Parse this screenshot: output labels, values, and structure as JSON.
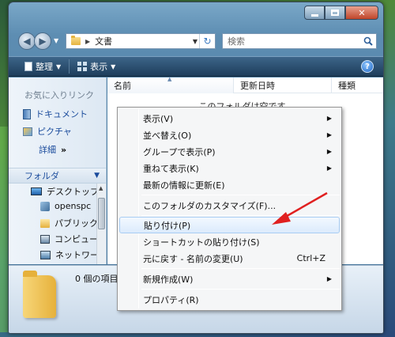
{
  "window": {
    "caption_buttons": [
      "minimize",
      "maximize",
      "close"
    ]
  },
  "address": {
    "path": "文書",
    "search_placeholder": "検索"
  },
  "toolbar": {
    "organize_label": "整理",
    "views_label": "表示",
    "help_label": "?"
  },
  "nav_pane": {
    "favorites_title": "お気に入りリンク",
    "favorites": [
      "ドキュメント",
      "ピクチャ"
    ],
    "more_label": "詳細",
    "more_chevrons": "»",
    "folders_title": "フォルダ",
    "tree": [
      "デスクトップ",
      "openspc",
      "パブリック",
      "コンピュー",
      "ネットワー"
    ]
  },
  "content": {
    "columns": [
      "名前",
      "更新日時",
      "種類"
    ],
    "empty_message": "このフォルダは空です。"
  },
  "details": {
    "item_count": "0 個の項目"
  },
  "context_menu": {
    "items": [
      {
        "label": "表示(V)",
        "submenu": true
      },
      {
        "label": "並べ替え(O)",
        "submenu": true
      },
      {
        "label": "グループで表示(P)",
        "submenu": true
      },
      {
        "label": "重ねて表示(K)",
        "submenu": true
      },
      {
        "label": "最新の情報に更新(E)"
      },
      {
        "label": "このフォルダのカスタマイズ(F)..."
      },
      {
        "label": "貼り付け(P)",
        "highlighted": true
      },
      {
        "label": "ショートカットの貼り付け(S)"
      },
      {
        "label": "元に戻す - 名前の変更(U)",
        "shortcut": "Ctrl+Z"
      },
      {
        "label": "新規作成(W)",
        "submenu": true
      },
      {
        "label": "プロパティ(R)"
      }
    ],
    "submenu_glyph": "▶"
  },
  "colors": {
    "annotation_arrow": "#e02020",
    "highlight": "#dcebfc"
  }
}
